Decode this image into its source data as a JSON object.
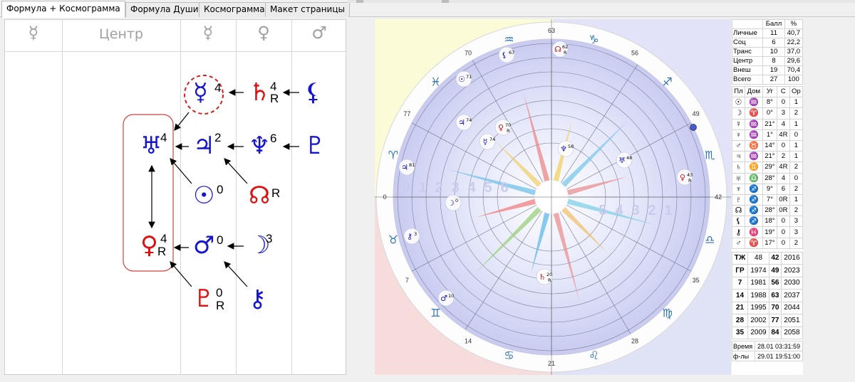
{
  "tabs": [
    {
      "label": "Формула + Космограмма",
      "active": true
    },
    {
      "label": "Формула Души",
      "active": false
    },
    {
      "label": "Космограмма",
      "active": false
    },
    {
      "label": "Макет страницы",
      "active": false
    }
  ],
  "formula": {
    "headers": [
      "☿",
      "Центр",
      "☿",
      "♀",
      "♂"
    ],
    "planets": [
      {
        "id": "mercury",
        "glyph": "☿",
        "num": "4",
        "r": "",
        "color": "blue"
      },
      {
        "id": "saturn",
        "glyph": "♄",
        "num": "4",
        "r": "R",
        "color": "red"
      },
      {
        "id": "lilith",
        "glyph": "⚸",
        "num": "",
        "r": "",
        "color": "blue"
      },
      {
        "id": "uranus",
        "glyph": "♅",
        "num": "4",
        "r": "",
        "color": "blue"
      },
      {
        "id": "jupiter",
        "glyph": "♃",
        "num": "2",
        "r": "",
        "color": "blue"
      },
      {
        "id": "neptune",
        "glyph": "♆",
        "num": "6",
        "r": "",
        "color": "blue"
      },
      {
        "id": "pluto",
        "glyph": "♇",
        "num": "",
        "r": "",
        "color": "blue"
      },
      {
        "id": "sun",
        "glyph": "☉",
        "num": "0",
        "r": "",
        "color": "blue"
      },
      {
        "id": "node",
        "glyph": "☊",
        "num": "",
        "r": "R",
        "color": "red"
      },
      {
        "id": "venus",
        "glyph": "♀",
        "num": "4",
        "r": "R",
        "color": "red"
      },
      {
        "id": "mars",
        "glyph": "♂",
        "num": "0",
        "r": "",
        "color": "blue"
      },
      {
        "id": "moon",
        "glyph": "☽",
        "num": "3",
        "r": "",
        "color": "blue"
      },
      {
        "id": "proserpina",
        "glyph": "♇",
        "num": "0",
        "r": "R",
        "color": "red"
      },
      {
        "id": "chiron",
        "glyph": "⚷",
        "num": "",
        "r": "",
        "color": "blue"
      }
    ]
  },
  "cosmogram": {
    "degree_labels": [
      "63",
      "56",
      "49",
      "42",
      "35",
      "28",
      "21",
      "14",
      "7",
      "0",
      "77",
      "70"
    ],
    "inner_numbers": [
      "0",
      "1",
      "2",
      "3",
      "4",
      "5",
      "6",
      "5",
      "4",
      "3",
      "2",
      "1"
    ],
    "planet_marks": [
      {
        "glyph": "☊",
        "label": "62",
        "r": "R"
      },
      {
        "glyph": "⚸",
        "label": "67",
        "r": ""
      },
      {
        "glyph": "☉",
        "label": "71",
        "r": ""
      },
      {
        "glyph": "♃",
        "label": "74",
        "r": ""
      },
      {
        "glyph": "♀",
        "label": "70",
        "r": "R"
      },
      {
        "glyph": "☿",
        "label": "74",
        "r": ""
      },
      {
        "glyph": "♆",
        "label": "58",
        "r": ""
      },
      {
        "glyph": "♅",
        "label": "48",
        "r": ""
      },
      {
        "glyph": "♀",
        "label": "43",
        "r": "R"
      },
      {
        "glyph": "♃",
        "label": "81",
        "r": ""
      },
      {
        "glyph": "☽",
        "label": "0",
        "r": ""
      },
      {
        "glyph": "⚷",
        "label": "3",
        "r": ""
      },
      {
        "glyph": "♄",
        "label": "20",
        "r": "R"
      },
      {
        "glyph": "♂",
        "label": "10",
        "r": ""
      }
    ],
    "signs": [
      "♑",
      "♐",
      "♏",
      "♎",
      "♍",
      "♌",
      "♋",
      "♊",
      "♉",
      "♈",
      "♓",
      "♒"
    ]
  },
  "stats": {
    "head": [
      "",
      "Балл",
      "%"
    ],
    "rows": [
      [
        "Личные",
        "11",
        "40,7"
      ],
      [
        "Соц",
        "6",
        "22,2"
      ],
      [
        "Транс",
        "10",
        "37,0"
      ],
      [
        "Центр",
        "8",
        "29,6"
      ],
      [
        "Внеш",
        "19",
        "70,4"
      ],
      [
        "Всего",
        "27",
        "100"
      ]
    ],
    "planet_head": [
      "Пл",
      "Дом",
      "Уг",
      "С",
      "Ор"
    ],
    "planet_rows": [
      [
        "☉",
        "♒",
        "8°",
        "0",
        "1"
      ],
      [
        "☽",
        "♈",
        "0°",
        "3",
        "2"
      ],
      [
        "☿",
        "♒",
        "21°",
        "4",
        "1"
      ],
      [
        "♀",
        "♒",
        "1°",
        "4R",
        "0"
      ],
      [
        "♂",
        "♉",
        "14°",
        "0",
        "1"
      ],
      [
        "♃",
        "♒",
        "21°",
        "2",
        "1"
      ],
      [
        "♄",
        "♊",
        "29°",
        "4R",
        "2"
      ],
      [
        "♅",
        "♎",
        "28°",
        "4",
        "0"
      ],
      [
        "♆",
        "♐",
        "9°",
        "6",
        "2"
      ],
      [
        "♇",
        "♐",
        "7°",
        "0R",
        "1"
      ],
      [
        "☊",
        "♐",
        "28°",
        "0R",
        "2"
      ],
      [
        "⚸",
        "♐",
        "18°",
        "0",
        "3"
      ],
      [
        "⚷",
        "♓",
        "19°",
        "0",
        "3"
      ],
      [
        "♂",
        "♈",
        "17°",
        "0",
        "2"
      ]
    ],
    "year_rows": [
      [
        "ТЖ",
        "48",
        "42",
        "2016"
      ],
      [
        "ГР",
        "1974",
        "49",
        "2023"
      ],
      [
        "7",
        "1981",
        "56",
        "2030"
      ],
      [
        "14",
        "1988",
        "63",
        "2037"
      ],
      [
        "21",
        "1995",
        "70",
        "2044"
      ],
      [
        "28",
        "2002",
        "77",
        "2051"
      ],
      [
        "35",
        "2009",
        "84",
        "2058"
      ]
    ],
    "time_rows": [
      [
        "Время",
        "28.01 03:31:59"
      ],
      [
        "ф-лы",
        "29.01 19:51:00"
      ]
    ]
  }
}
